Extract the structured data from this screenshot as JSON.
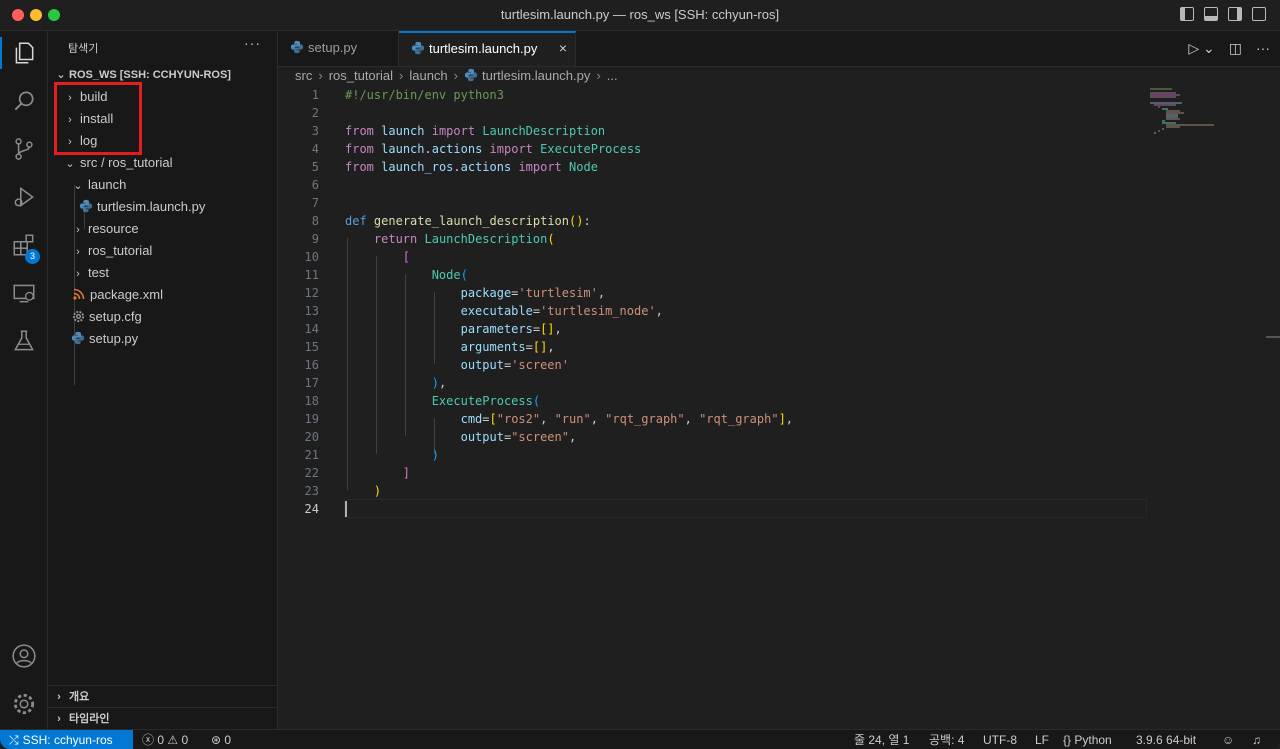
{
  "window": {
    "title": "turtlesim.launch.py — ros_ws [SSH: cchyun-ros]"
  },
  "activity_bar": {
    "extensions_badge": "3"
  },
  "explorer": {
    "title": "탐색기",
    "more": "···",
    "root": "ROS_WS [SSH: CCHYUN-ROS]",
    "items": [
      {
        "label": "build",
        "chevron": "›"
      },
      {
        "label": "install",
        "chevron": "›"
      },
      {
        "label": "log",
        "chevron": "›"
      },
      {
        "label": "src / ros_tutorial",
        "chevron": "⌄"
      },
      {
        "label": "launch",
        "chevron": "⌄"
      },
      {
        "label": "turtlesim.launch.py"
      },
      {
        "label": "resource",
        "chevron": "›"
      },
      {
        "label": "ros_tutorial",
        "chevron": "›"
      },
      {
        "label": "test",
        "chevron": "›"
      },
      {
        "label": "package.xml"
      },
      {
        "label": "setup.cfg"
      },
      {
        "label": "setup.py"
      }
    ],
    "outline": "개요",
    "timeline": "타임라인",
    "section_chevron": "›"
  },
  "tabs": [
    {
      "label": "setup.py"
    },
    {
      "label": "turtlesim.launch.py",
      "close": "×"
    }
  ],
  "breadcrumb": {
    "parts": [
      "src",
      "ros_tutorial",
      "launch",
      "turtlesim.launch.py",
      "..."
    ],
    "sep": "›"
  },
  "editor": {
    "line_numbers": [
      "1",
      "2",
      "3",
      "4",
      "5",
      "6",
      "7",
      "8",
      "9",
      "10",
      "11",
      "12",
      "13",
      "14",
      "15",
      "16",
      "17",
      "18",
      "19",
      "20",
      "21",
      "22",
      "23",
      "24"
    ],
    "current_line": "24",
    "code": {
      "shebang": "#!/usr/bin/env python3",
      "from": "from",
      "import": "import",
      "mod_launch": "launch",
      "cls_launchdesc": "LaunchDescription",
      "mod_launch_actions_a": "launch",
      "mod_launch_actions_b": "actions",
      "cls_execproc": "ExecuteProcess",
      "mod_launch_ros_a": "launch_ros",
      "mod_launch_ros_b": "actions",
      "cls_node": "Node",
      "def": "def",
      "fn_name": "generate_launch_description",
      "ret": "return",
      "kw_package": "package",
      "str_turtlesim": "'turtlesim'",
      "kw_executable": "executable",
      "str_turtlesim_node": "'turtlesim_node'",
      "kw_parameters": "parameters",
      "kw_arguments": "arguments",
      "kw_output": "output",
      "str_screen_sq": "'screen'",
      "kw_cmd": "cmd",
      "str_ros2": "\"ros2\"",
      "str_run": "\"run\"",
      "str_rqt1": "\"rqt_graph\"",
      "str_rqt2": "\"rqt_graph\"",
      "str_screen_dq": "\"screen\""
    }
  },
  "status_bar": {
    "remote": "SSH: cchyun-ros",
    "errors": "0",
    "warnings": "0",
    "ports": "0",
    "position": "줄 24, 열 1",
    "spaces": "공백: 4",
    "encoding": "UTF-8",
    "eol": "LF",
    "language": "Python",
    "interpreter": "3.9.6 64-bit"
  },
  "colors": {
    "accent": "#0078d4",
    "highlight_box": "#e41e1e"
  }
}
